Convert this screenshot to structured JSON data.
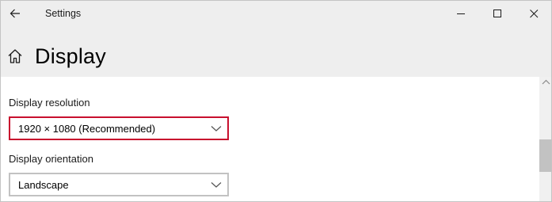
{
  "window": {
    "title": "Settings",
    "icons": {
      "back": "back-arrow-icon",
      "minimize": "minimize-icon",
      "maximize": "maximize-icon",
      "close": "close-icon"
    }
  },
  "header": {
    "icon": "home-icon",
    "title": "Display"
  },
  "settings": {
    "resolution": {
      "label": "Display resolution",
      "value": "1920 × 1080 (Recommended)",
      "highlighted": true,
      "highlight_color": "#c8102e"
    },
    "orientation": {
      "label": "Display orientation",
      "value": "Landscape"
    }
  },
  "colors": {
    "titlebar_bg": "#eeeeee",
    "content_bg": "#ffffff",
    "dropdown_border": "#c2c2c2",
    "scroll_thumb": "#c2c2c2"
  }
}
